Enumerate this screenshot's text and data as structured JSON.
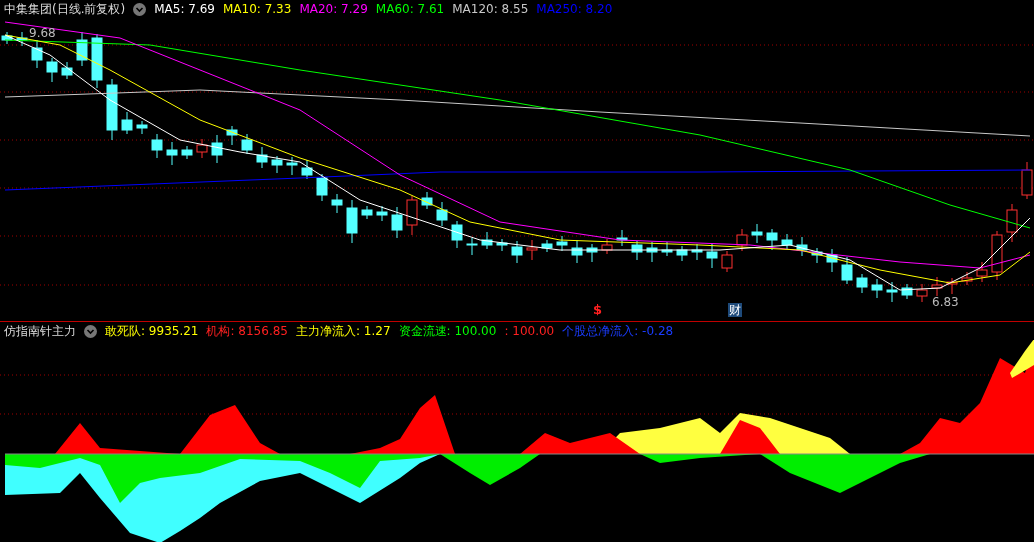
{
  "main_chart": {
    "title": "中集集团(日线.前复权)",
    "ma_legend": [
      {
        "text": "MA5: 7.69",
        "color": "#ffffff"
      },
      {
        "text": "MA10: 7.33",
        "color": "#ffff00"
      },
      {
        "text": "MA20: 7.29",
        "color": "#ff00ff"
      },
      {
        "text": "MA60: 7.61",
        "color": "#00ff00"
      },
      {
        "text": "MA120: 8.55",
        "color": "#c8c8c8"
      },
      {
        "text": "MA250: 8.20",
        "color": "#0000ff"
      }
    ],
    "high_label": "9.68",
    "low_label": "6.83",
    "markers": [
      {
        "kind": "dividend",
        "text": "$"
      },
      {
        "kind": "finance",
        "text": "财"
      }
    ]
  },
  "indicator": {
    "title": "仿指南针主力",
    "legend": [
      {
        "text": "敢死队: 9935.21",
        "color": "#ffff00"
      },
      {
        "text": "机构: 8156.85",
        "color": "#ff2020"
      },
      {
        "text": "主力净流入: 1.27",
        "color": "#ffff00"
      },
      {
        "text": "资金流速: 100.00",
        "color": "#00ff00"
      },
      {
        "text": ": 100.00",
        "color": "#ff2020"
      },
      {
        "text": "个股总净流入: -0.28",
        "color": "#1a3cff"
      }
    ]
  }
}
